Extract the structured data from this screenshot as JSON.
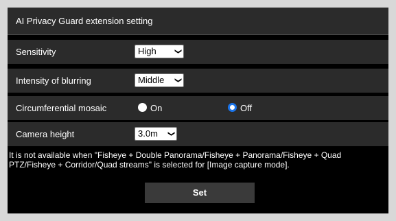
{
  "title": "AI Privacy Guard extension setting",
  "rows": {
    "sensitivity": {
      "label": "Sensitivity",
      "value": "High"
    },
    "blurring": {
      "label": "Intensity of blurring",
      "value": "Middle"
    },
    "mosaic": {
      "label": "Circumferential mosaic",
      "on_label": "On",
      "off_label": "Off",
      "selected": "Off"
    },
    "camera_height": {
      "label": "Camera height",
      "value": "3.0m"
    }
  },
  "note": "It is not available when \"Fisheye + Double Panorama/Fisheye + Panorama/Fisheye + Quad PTZ/Fisheye + Corridor/Quad streams\" is selected for [Image capture mode].",
  "set_button": "Set",
  "icons": {
    "dropdown": "chevron-down-icon"
  },
  "colors": {
    "panel_bg": "#000000",
    "row_bg": "#2b2b2b",
    "radio_accent": "#1a73e8"
  }
}
